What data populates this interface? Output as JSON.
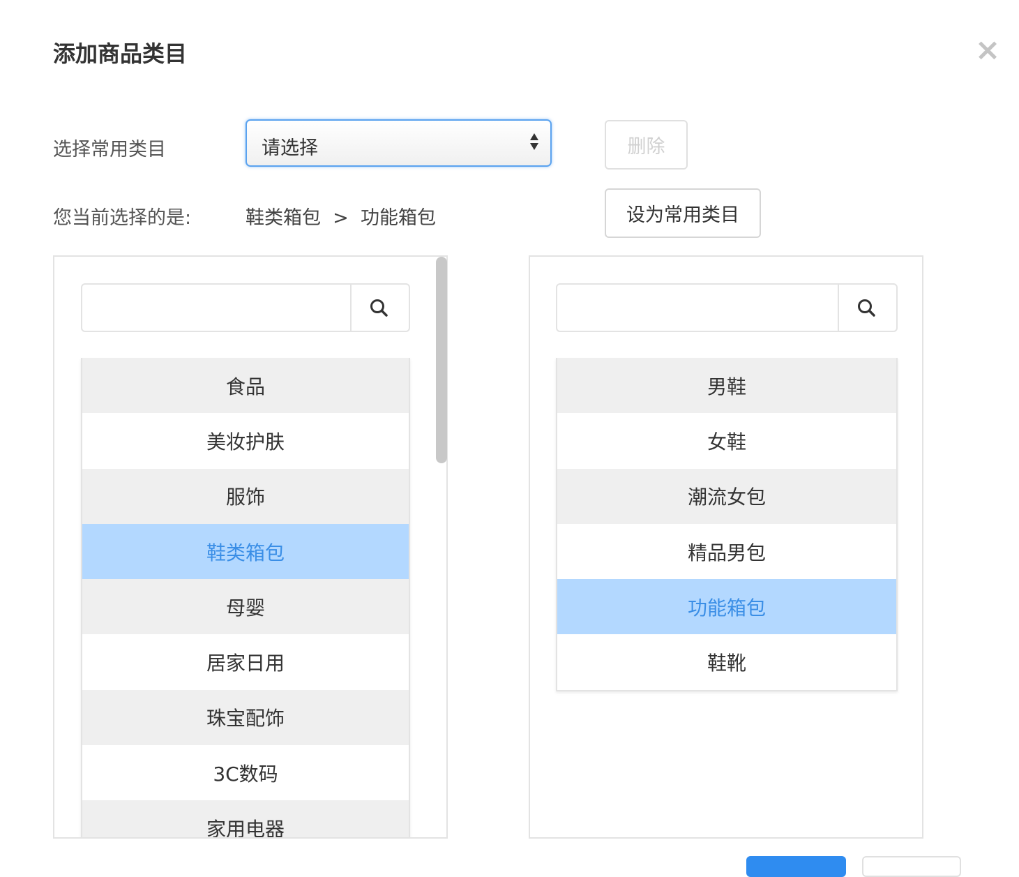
{
  "dialog": {
    "title": "添加商品类目"
  },
  "form": {
    "common_label": "选择常用类目",
    "select_value": "请选择",
    "delete_label": "删除",
    "current_label": "您当前选择的是:",
    "current_path": "鞋类箱包  >  功能箱包",
    "set_common_label": "设为常用类目"
  },
  "left_list": {
    "items": [
      "食品",
      "美妆护肤",
      "服饰",
      "鞋类箱包",
      "母婴",
      "居家日用",
      "珠宝配饰",
      "3C数码",
      "家用电器"
    ],
    "selected": "鞋类箱包"
  },
  "right_list": {
    "items": [
      "男鞋",
      "女鞋",
      "潮流女包",
      "精品男包",
      "功能箱包",
      "鞋靴"
    ],
    "selected": "功能箱包"
  },
  "colors": {
    "accent": "#2f8cf0",
    "selected_bg": "#b3d8ff",
    "selected_text": "#3a8ee6"
  }
}
